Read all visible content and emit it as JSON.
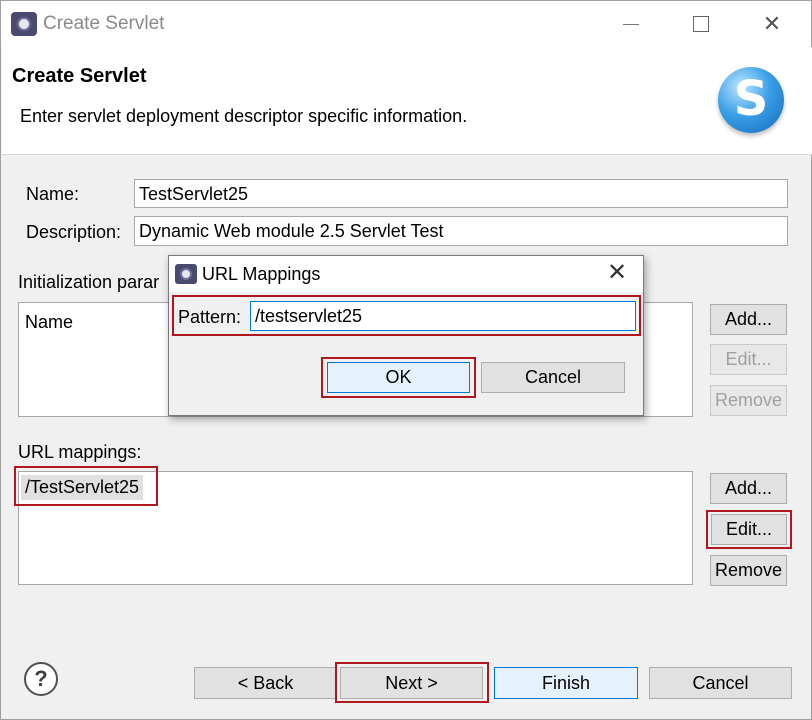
{
  "window": {
    "title": "Create Servlet",
    "minimize_icon": "minimize-icon",
    "maximize_icon": "maximize-icon",
    "close_glyph": "✕"
  },
  "header": {
    "title": "Create Servlet",
    "description": "Enter servlet deployment descriptor specific information.",
    "logo_letter": "S"
  },
  "form": {
    "name_label": "Name:",
    "name_value": "TestServlet25",
    "description_label": "Description:",
    "description_value": "Dynamic Web module 2.5 Servlet Test",
    "init_params_label": "Initialization parar",
    "init_params": {
      "column_header": "Name",
      "add_label": "Add...",
      "edit_label": "Edit...",
      "remove_label": "Remove"
    },
    "url_mappings_label": "URL mappings:",
    "url_mappings": {
      "items": [
        "/TestServlet25"
      ],
      "add_label": "Add...",
      "edit_label": "Edit...",
      "remove_label": "Remove"
    }
  },
  "footer": {
    "help_glyph": "?",
    "back_label": "< Back",
    "next_label": "Next >",
    "finish_label": "Finish",
    "cancel_label": "Cancel"
  },
  "dialog": {
    "title": "URL Mappings",
    "close_glyph": "✕",
    "pattern_label": "Pattern:",
    "pattern_value": "/testservlet25",
    "ok_label": "OK",
    "cancel_label": "Cancel"
  },
  "colors": {
    "highlight": "#b01820",
    "window_bg": "#f0f0f0",
    "logo_blue": "#3aa0e8"
  }
}
